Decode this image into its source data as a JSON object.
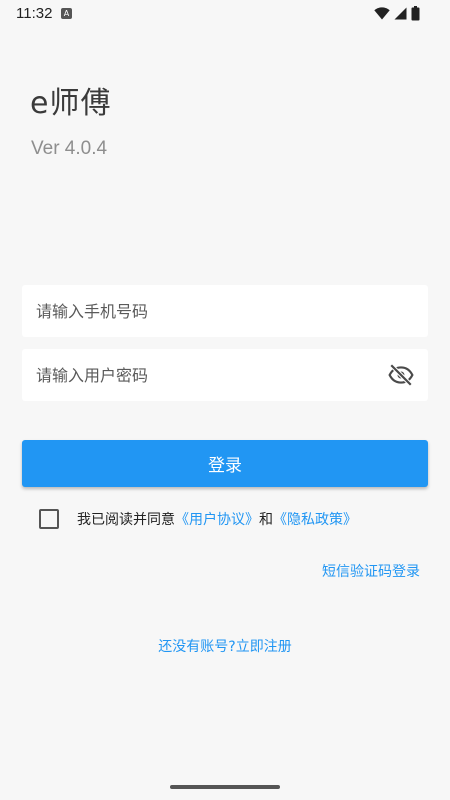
{
  "status_bar": {
    "time": "11:32",
    "notification_icon_letter": "A",
    "icons": [
      "wifi-icon",
      "signal-icon",
      "battery-icon"
    ]
  },
  "app": {
    "title": "e师傅",
    "version": "Ver 4.0.4"
  },
  "form": {
    "phone_placeholder": "请输入手机号码",
    "password_placeholder": "请输入用户密码",
    "phone_value": "",
    "password_value": "",
    "password_visibility_icon": "eye-off-icon",
    "login_label": "登录"
  },
  "agreement": {
    "checked": false,
    "prefix": "我已阅读并同意",
    "user_agreement": "《用户协议》",
    "and": "和",
    "privacy_policy": "《隐私政策》"
  },
  "links": {
    "sms_login": "短信验证码登录",
    "register": "还没有账号?立即注册"
  },
  "colors": {
    "accent": "#2196f3",
    "background": "#f7f7f7",
    "field_background": "#ffffff"
  }
}
